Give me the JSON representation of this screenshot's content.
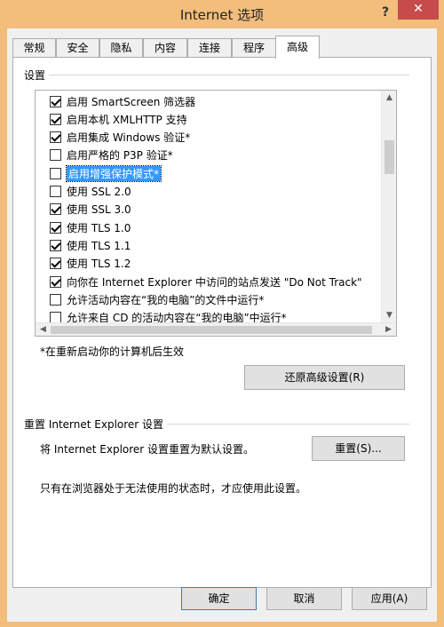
{
  "window": {
    "title": "Internet 选项",
    "help_glyph": "?",
    "close_glyph": "✕"
  },
  "tabs": [
    {
      "label": "常规"
    },
    {
      "label": "安全"
    },
    {
      "label": "隐私"
    },
    {
      "label": "内容"
    },
    {
      "label": "连接"
    },
    {
      "label": "程序"
    },
    {
      "label": "高级",
      "active": true
    }
  ],
  "settings": {
    "label": "设置",
    "items": [
      {
        "label": "启用 SmartScreen 筛选器",
        "checked": true
      },
      {
        "label": "启用本机 XMLHTTP 支持",
        "checked": true
      },
      {
        "label": "启用集成 Windows 验证*",
        "checked": true
      },
      {
        "label": "启用严格的 P3P 验证*",
        "checked": false
      },
      {
        "label": "启用增强保护模式*",
        "checked": false,
        "selected": true
      },
      {
        "label": "使用 SSL 2.0",
        "checked": false
      },
      {
        "label": "使用 SSL 3.0",
        "checked": true
      },
      {
        "label": "使用 TLS 1.0",
        "checked": true
      },
      {
        "label": "使用 TLS 1.1",
        "checked": true
      },
      {
        "label": "使用 TLS 1.2",
        "checked": true
      },
      {
        "label": "向你在 Internet Explorer 中访问的站点发送 \"Do Not Track\"",
        "checked": true
      },
      {
        "label": "允许活动内容在“我的电脑”的文件中运行*",
        "checked": false
      },
      {
        "label": "允许来自 CD 的活动内容在“我的电脑”中运行*",
        "checked": false
      }
    ],
    "restart_note": "*在重新启动你的计算机后生效",
    "restore_button": "还原高级设置(R)"
  },
  "reset": {
    "label": "重置 Internet Explorer 设置",
    "description": "将 Internet Explorer 设置重置为默认设置。",
    "button": "重置(S)...",
    "warning": "只有在浏览器处于无法使用的状态时，才应使用此设置。"
  },
  "footer": {
    "ok": "确定",
    "cancel": "取消",
    "apply": "应用(A)"
  }
}
